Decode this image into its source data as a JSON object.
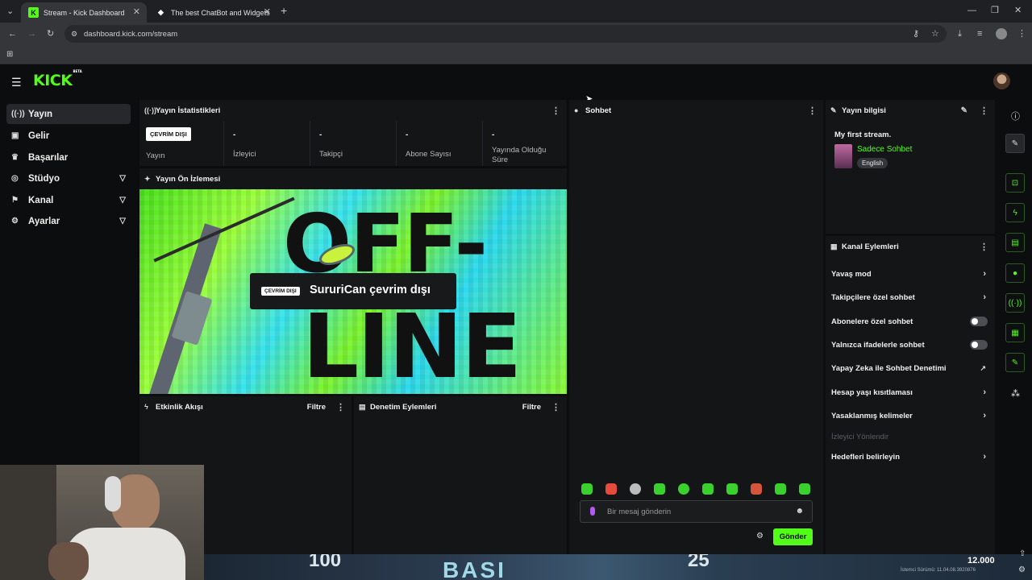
{
  "browser": {
    "tabs": [
      {
        "title": "Stream - Kick Dashboard",
        "active": true
      },
      {
        "title": "The best ChatBot and Widgets",
        "active": false
      }
    ],
    "url": "dashboard.kick.com/stream"
  },
  "brand": {
    "logo": "KICK",
    "badge": "BETA",
    "accent": "#53fc18"
  },
  "sidebar": {
    "items": [
      {
        "label": "Yayın",
        "icon": "broadcast-icon",
        "active": true,
        "expandable": false
      },
      {
        "label": "Gelir",
        "icon": "revenue-icon",
        "expandable": false
      },
      {
        "label": "Başarılar",
        "icon": "trophy-icon",
        "expandable": false
      },
      {
        "label": "Stüdyo",
        "icon": "studio-icon",
        "expandable": true
      },
      {
        "label": "Kanal",
        "icon": "channel-icon",
        "expandable": true
      },
      {
        "label": "Ayarlar",
        "icon": "settings-icon",
        "expandable": true
      }
    ]
  },
  "stats": {
    "title": "Yayın İstatistikleri",
    "offline_badge": "ÇEVRİM DIŞI",
    "items": [
      {
        "label": "Yayın"
      },
      {
        "value": "-",
        "label": "İzleyici"
      },
      {
        "value": "-",
        "label": "Takipçi"
      },
      {
        "value": "-",
        "label": "Abone Sayısı"
      },
      {
        "value": "-",
        "label": "Yayında Olduğu Süre"
      }
    ]
  },
  "preview": {
    "title": "Yayın Ön İzlemesi",
    "badge": "ÇEVRİM DIŞI",
    "message": "SururiCan çevrim dışı",
    "art_text_1": "OFF-",
    "art_text_2": "LINE"
  },
  "activity": {
    "title": "Etkinlik Akışı",
    "filter": "Filtre"
  },
  "moderation": {
    "title": "Denetim Eylemleri",
    "filter": "Filtre"
  },
  "chat": {
    "title": "Sohbet",
    "placeholder": "Bir mesaj gönderin",
    "send": "Gönder"
  },
  "stream_info": {
    "title": "Yayın bilgisi",
    "stream_title": "My first stream.",
    "category": "Sadece Sohbet",
    "language": "English"
  },
  "channel_actions": {
    "title": "Kanal Eylemleri",
    "items": [
      {
        "label": "Yavaş mod",
        "type": "arrow"
      },
      {
        "label": "Takipçilere özel sohbet",
        "type": "arrow"
      },
      {
        "label": "Abonelere özel sohbet",
        "type": "toggle"
      },
      {
        "label": "Yalnızca ifadelerle sohbet",
        "type": "toggle"
      },
      {
        "label": "Yapay Zeka ile Sohbet Denetimi",
        "type": "external"
      },
      {
        "label": "Hesap yaşı kısıtlaması",
        "type": "arrow"
      },
      {
        "label": "Yasaklanmış kelimeler",
        "type": "arrow"
      },
      {
        "label": "İzleyici Yönlendir",
        "type": "disabled"
      },
      {
        "label": "Hedefleri belirleyin",
        "type": "arrow"
      }
    ]
  },
  "overlay": {
    "score_right": "12.000",
    "score_left": "100",
    "score_mid": "25",
    "banner": "BASI",
    "version": "İstemci Sürümü: 11.04.08.3920876"
  }
}
